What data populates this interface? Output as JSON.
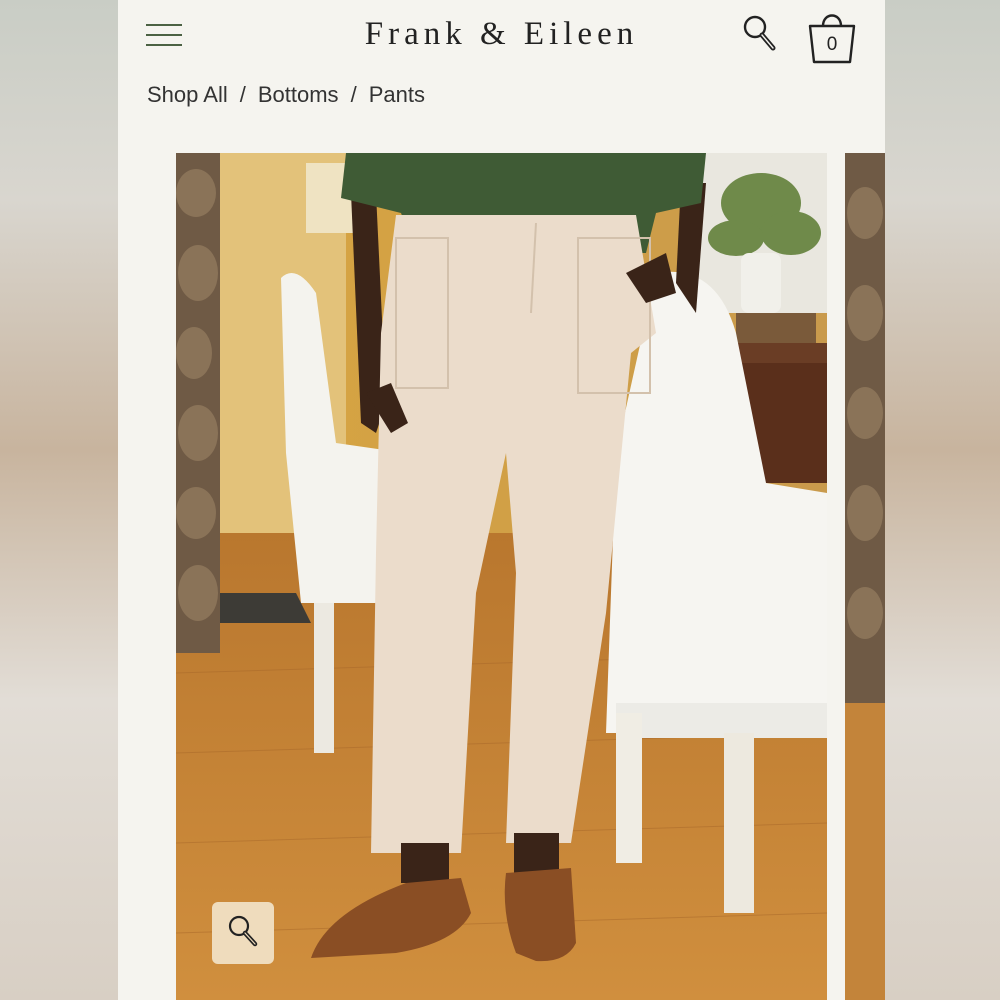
{
  "header": {
    "brand": "Frank & Eileen",
    "menu_icon": "hamburger-menu-icon",
    "search_icon": "search-icon",
    "bag_icon": "shopping-bag-icon",
    "bag_count": "0"
  },
  "breadcrumb": {
    "items": [
      "Shop All",
      "Bottoms",
      "Pants"
    ],
    "separator": "/"
  },
  "gallery": {
    "zoom_icon": "zoom-icon"
  },
  "colors": {
    "page_bg": "#f5f4ef",
    "menu_accent": "#4c6244",
    "zoom_badge": "#efdcbd"
  }
}
